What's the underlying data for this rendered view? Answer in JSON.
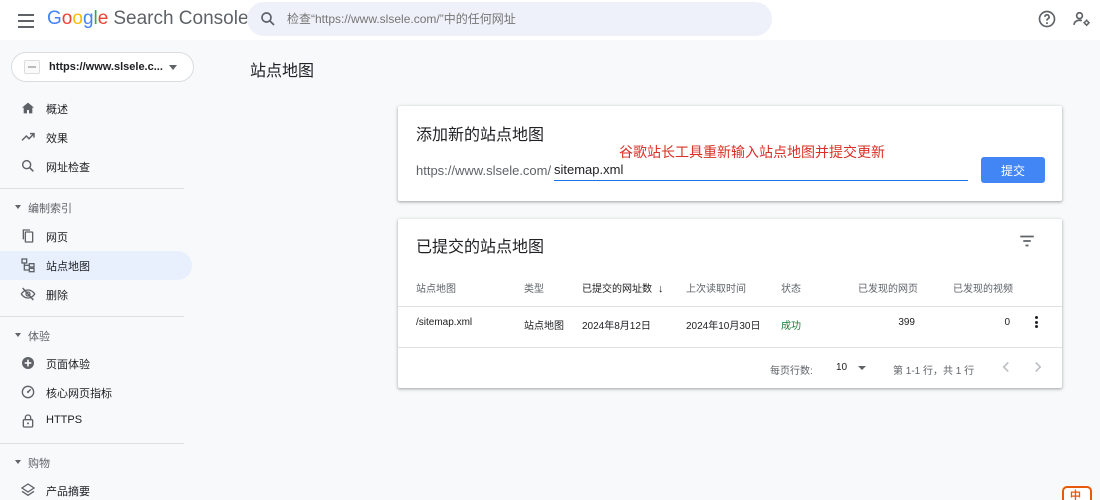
{
  "app": {
    "logo_letters": [
      "G",
      "o",
      "o",
      "g",
      "l",
      "e"
    ],
    "logo_product": "Search Console"
  },
  "search": {
    "placeholder": "检查“https://www.slsele.com/”中的任何网址",
    "value": ""
  },
  "header_icons": [
    "help-icon",
    "account-settings-icon"
  ],
  "property": {
    "label": "https://www.slsele.c..."
  },
  "sidebar": {
    "items": [
      {
        "label": "概述",
        "icon": "home-icon"
      },
      {
        "label": "效果",
        "icon": "trending-up-icon"
      },
      {
        "label": "网址检查",
        "icon": "search-icon"
      }
    ],
    "sections": [
      {
        "label": "编制索引",
        "items": [
          {
            "label": "网页",
            "icon": "pages-icon"
          },
          {
            "label": "站点地图",
            "icon": "sitemap-icon",
            "active": true
          },
          {
            "label": "删除",
            "icon": "removal-icon"
          }
        ]
      },
      {
        "label": "体验",
        "items": [
          {
            "label": "页面体验",
            "icon": "page-experience-icon"
          },
          {
            "label": "核心网页指标",
            "icon": "core-web-vitals-icon"
          },
          {
            "label": "HTTPS",
            "icon": "lock-icon"
          }
        ]
      },
      {
        "label": "购物",
        "items": [
          {
            "label": "产品摘要",
            "icon": "layers-icon"
          }
        ]
      }
    ]
  },
  "page": {
    "title": "站点地图"
  },
  "add_card": {
    "title": "添加新的站点地图",
    "annotation": "谷歌站长工具重新输入站点地图并提交更新",
    "prefix": "https://www.slsele.com/",
    "input_value": "sitemap.xml",
    "submit_label": "提交"
  },
  "submitted_card": {
    "title": "已提交的站点地图",
    "columns": [
      "站点地图",
      "类型",
      "已提交的网址数",
      "上次读取时间",
      "状态",
      "已发现的网页",
      "已发现的视频"
    ],
    "sorted_column_arrow": "↓",
    "rows": [
      {
        "sitemap": "/sitemap.xml",
        "type": "站点地图",
        "submitted": "2024年8月12日",
        "last_read": "2024年10月30日",
        "status": "成功",
        "pages": "399",
        "videos": "0"
      }
    ],
    "rows_per_page_label": "每页行数:",
    "rows_per_page": "10",
    "range_text": "第 1-1 行，共 1 行"
  },
  "colors": {
    "accent": "#1a73e8",
    "button": "#4285f4",
    "active_nav": "#e8f0fe",
    "success": "#188038",
    "annotation": "#d93025"
  },
  "corner_badge": "中"
}
